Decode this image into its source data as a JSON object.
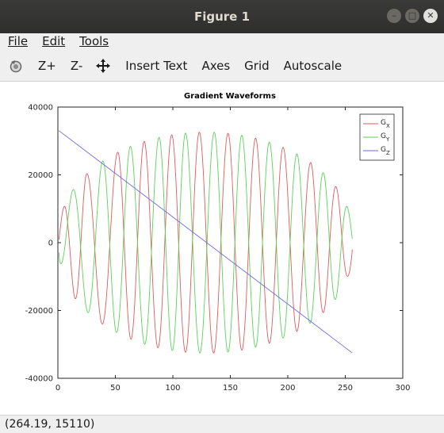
{
  "window": {
    "title": "Figure 1"
  },
  "menu": {
    "file": "File",
    "edit": "Edit",
    "tools": "Tools"
  },
  "toolbar": {
    "zoom_in": "Z+",
    "zoom_out": "Z-",
    "insert_text": "Insert Text",
    "axes": "Axes",
    "grid": "Grid",
    "autoscale": "Autoscale"
  },
  "status": {
    "coords": "(264.19, 15110)"
  },
  "chart_data": {
    "type": "line",
    "title": "Gradient Waveforms",
    "xlabel": "",
    "ylabel": "",
    "xlim": [
      0,
      300
    ],
    "ylim": [
      -40000,
      40000
    ],
    "xticks": [
      0,
      50,
      100,
      150,
      200,
      250,
      300
    ],
    "yticks": [
      -40000,
      -20000,
      0,
      20000,
      40000
    ],
    "grid": false,
    "legend_position": "top-right",
    "series": [
      {
        "name": "GX",
        "base": "G",
        "sub": "X",
        "color": "#e05a5a",
        "form": "chirp-sine",
        "amplitude_max": 32600,
        "amplitude_end": 3000,
        "x_range": [
          1,
          256
        ],
        "peaks_x": [
          5,
          25,
          52,
          75,
          99,
          123,
          148,
          172,
          196,
          220,
          242
        ]
      },
      {
        "name": "GY",
        "base": "G",
        "sub": "Y",
        "color": "#5ad25a",
        "form": "chirp-cosine",
        "amplitude_max": 32600,
        "amplitude_end": 3000,
        "x_range": [
          1,
          256
        ],
        "peaks_x": [
          13,
          39,
          63,
          88,
          111,
          136,
          160,
          184,
          208,
          231,
          252
        ]
      },
      {
        "name": "GZ",
        "base": "G",
        "sub": "Z",
        "color": "#6a6ae8",
        "form": "linear",
        "x": [
          1,
          256
        ],
        "y": [
          33000,
          -32500
        ]
      }
    ]
  }
}
